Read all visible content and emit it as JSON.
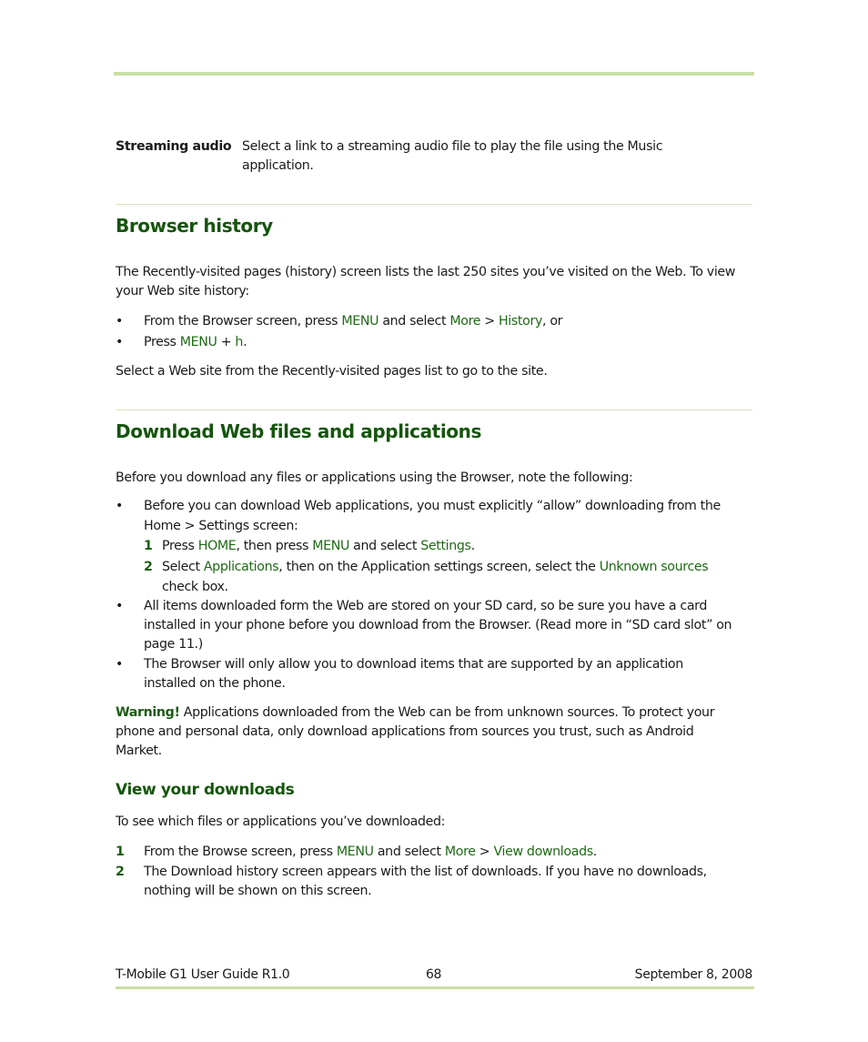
{
  "colors": {
    "accent_bar": "#c9dfa3",
    "heading_green": "#15550c",
    "keyword_green": "#1e6a14"
  },
  "definition_row": {
    "term": "Streaming audio",
    "desc_line1": "Select a link to a streaming audio file to play the file using the Music",
    "desc_line2": "application."
  },
  "browser_history": {
    "heading": "Browser history",
    "intro_line1": "The Recently-visited pages (history) screen lists the last 250 sites you’ve visited on the Web. To view",
    "intro_line2": "your Web site history:",
    "bullet_char": "•",
    "bullet1": {
      "t1": "From the Browser screen, press ",
      "k1": "MENU",
      "t2": " and select ",
      "k2": "More",
      "t3": " > ",
      "k3": "History",
      "t4": ", or"
    },
    "bullet2": {
      "t1": "Press ",
      "k1": "MENU",
      "t2": " + ",
      "k2": "h",
      "t3": "."
    },
    "outro": "Select a Web site from the Recently-visited pages list to go to the site."
  },
  "download": {
    "heading": "Download Web files and applications",
    "intro": "Before you download any files or applications using the Browser, note the following:",
    "bullet1_line1": "Before you can download Web applications, you must explicitly “allow” downloading from the",
    "bullet1_line2": "Home > Settings screen:",
    "step1": {
      "num": "1",
      "t1": "Press ",
      "k1": "HOME",
      "t2": ", then press ",
      "k2": "MENU",
      "t3": " and select ",
      "k3": "Settings",
      "t4": "."
    },
    "step2": {
      "num": "2",
      "t1": "Select ",
      "k1": "Applications",
      "t2": ", then on the Application settings screen, select the ",
      "k2": "Unknown sources",
      "line2": "check box."
    },
    "bullet2_line1": "All items downloaded form the Web are stored on your SD card, so be sure you have a card",
    "bullet2_line2": "installed in your phone before you download from the Browser. (Read more in “SD card slot” on",
    "bullet2_line3": "page 11.)",
    "bullet3_line1": "The Browser will only allow you to download items that are supported by an application",
    "bullet3_line2": "installed on the phone.",
    "warning": {
      "label": "Warning!",
      "line1": " Applications downloaded from the Web can be from unknown sources. To protect your",
      "line2": "phone and personal data, only download applications from sources you trust, such as Android",
      "line3": "Market."
    }
  },
  "view_downloads": {
    "heading": "View your downloads",
    "intro": "To see which files or applications you’ve downloaded:",
    "step1": {
      "num": "1",
      "t1": "From the Browse screen, press ",
      "k1": "MENU",
      "t2": " and select ",
      "k2": "More",
      "t3": " > ",
      "k3": "View downloads",
      "t4": "."
    },
    "step2": {
      "num": "2",
      "line1": "The Download history screen appears with the list of downloads. If you have no downloads,",
      "line2": "nothing will be shown on this screen."
    }
  },
  "footer": {
    "left": "T-Mobile G1 User Guide R1.0",
    "page_number": "68",
    "date": "September 8, 2008"
  }
}
